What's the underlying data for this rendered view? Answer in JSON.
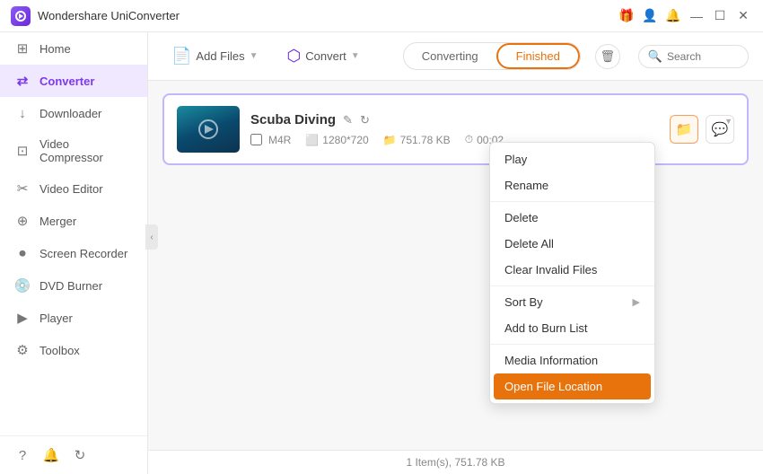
{
  "app": {
    "title": "Wondershare UniConverter",
    "logo_color": "#7c3aed"
  },
  "titlebar": {
    "controls": {
      "gift": "🎁",
      "user": "👤",
      "bell": "🔔",
      "minimize": "—",
      "maximize": "☐",
      "close": "✕"
    }
  },
  "sidebar": {
    "items": [
      {
        "id": "home",
        "label": "Home",
        "icon": "⊞"
      },
      {
        "id": "converter",
        "label": "Converter",
        "icon": "⇄",
        "active": true
      },
      {
        "id": "downloader",
        "label": "Downloader",
        "icon": "↓"
      },
      {
        "id": "video-compressor",
        "label": "Video Compressor",
        "icon": "⊡"
      },
      {
        "id": "video-editor",
        "label": "Video Editor",
        "icon": "✂"
      },
      {
        "id": "merger",
        "label": "Merger",
        "icon": "⊕"
      },
      {
        "id": "screen-recorder",
        "label": "Screen Recorder",
        "icon": "⏺"
      },
      {
        "id": "dvd-burner",
        "label": "DVD Burner",
        "icon": "💿"
      },
      {
        "id": "player",
        "label": "Player",
        "icon": "▶"
      },
      {
        "id": "toolbox",
        "label": "Toolbox",
        "icon": "⚙"
      }
    ],
    "bottom_icons": [
      "?",
      "🔔",
      "↻"
    ]
  },
  "toolbar": {
    "add_files_label": "Add Files",
    "add_btn_label": "+",
    "convert_label": "Convert",
    "tab_converting": "Converting",
    "tab_finished": "Finished",
    "search_placeholder": "Search",
    "delete_icon": "🗑"
  },
  "file": {
    "name": "Scuba Diving",
    "format": "M4R",
    "resolution": "1280*720",
    "size": "751.78 KB",
    "duration": "00:02",
    "edit_icon": "✎",
    "refresh_icon": "↻"
  },
  "context_menu": {
    "items": [
      {
        "label": "Play",
        "has_arrow": false
      },
      {
        "label": "Rename",
        "has_arrow": false
      },
      {
        "label": "Delete",
        "has_arrow": false
      },
      {
        "label": "Delete All",
        "has_arrow": false
      },
      {
        "label": "Clear Invalid Files",
        "has_arrow": false
      },
      {
        "label": "Sort By",
        "has_arrow": true
      },
      {
        "label": "Add to Burn List",
        "has_arrow": false
      },
      {
        "label": "Media Information",
        "has_arrow": false
      },
      {
        "label": "Open File Location",
        "has_arrow": false,
        "highlighted": true
      }
    ]
  },
  "statusbar": {
    "text": "1 Item(s), 751.78 KB"
  }
}
